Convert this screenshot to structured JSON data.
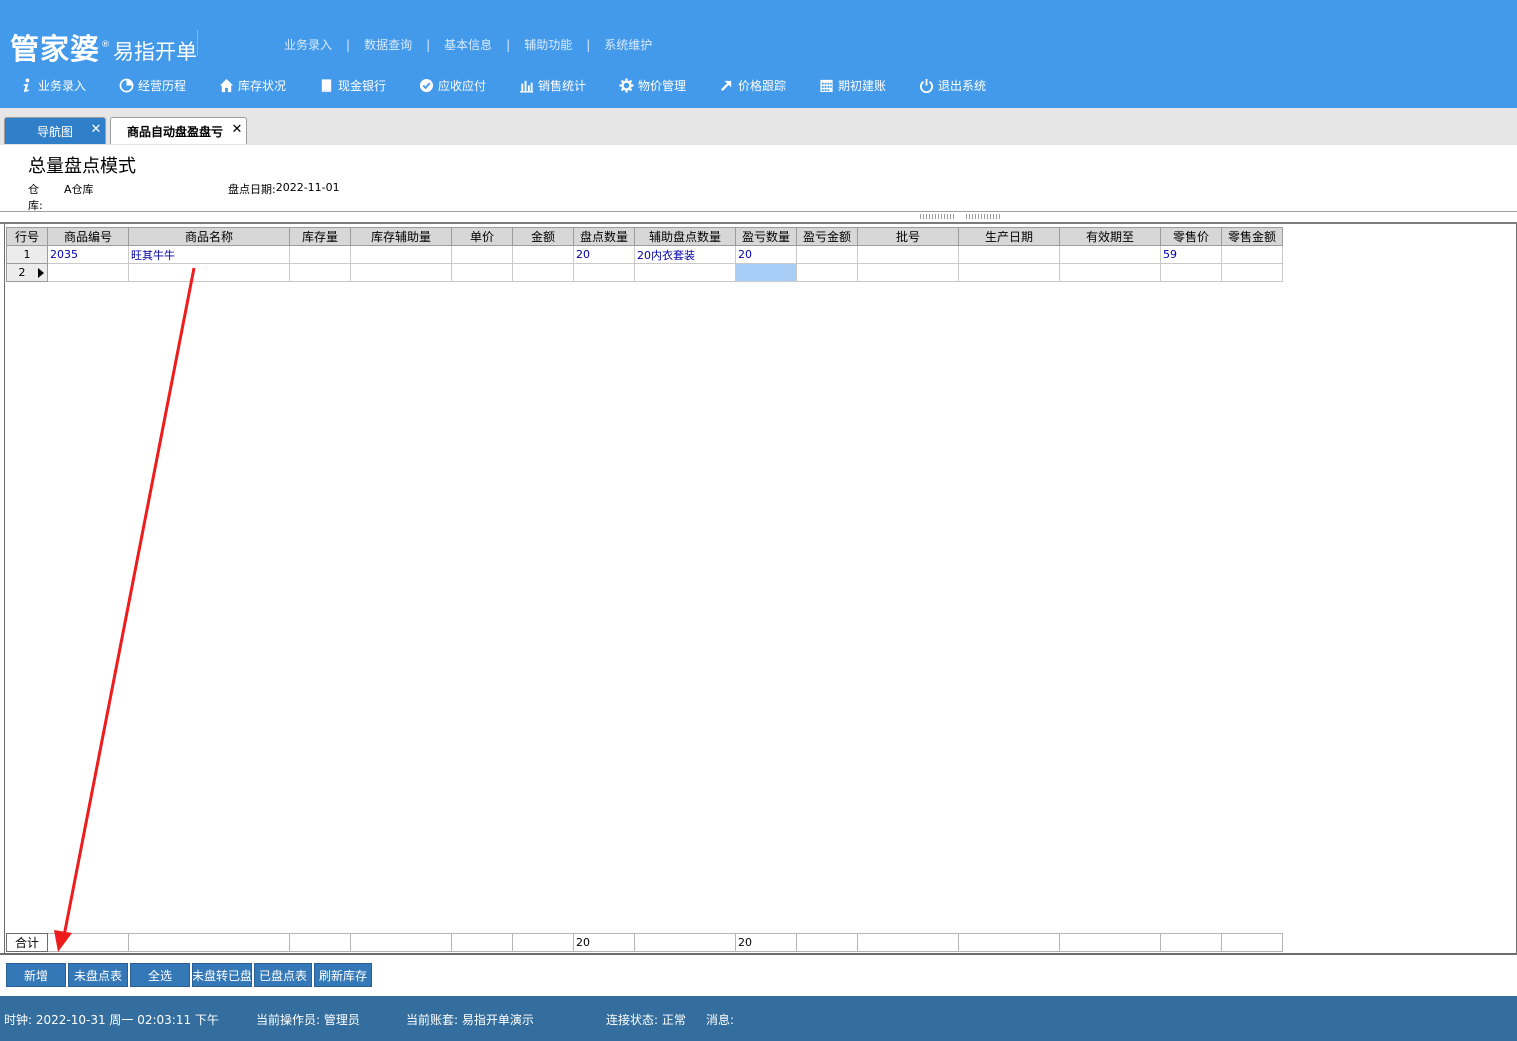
{
  "header": {
    "brand": "管家婆",
    "registered_mark": "®",
    "product": "易指开单",
    "topnav": [
      "业务录入",
      "数据查询",
      "基本信息",
      "辅助功能",
      "系统维护"
    ],
    "topnav_separator": "|"
  },
  "toolbar": {
    "items": [
      {
        "label": "业务录入",
        "icon": "info-icon"
      },
      {
        "label": "经营历程",
        "icon": "pie-chart-icon"
      },
      {
        "label": "库存状况",
        "icon": "home-icon"
      },
      {
        "label": "现金银行",
        "icon": "book-icon"
      },
      {
        "label": "应收应付",
        "icon": "check-circle-icon"
      },
      {
        "label": "销售统计",
        "icon": "bar-chart-icon"
      },
      {
        "label": "物价管理",
        "icon": "gear-icon"
      },
      {
        "label": "价格跟踪",
        "icon": "arrow-up-right-icon"
      },
      {
        "label": "期初建账",
        "icon": "calendar-icon"
      },
      {
        "label": "退出系统",
        "icon": "power-icon"
      }
    ]
  },
  "tabs": [
    {
      "label": "导航图",
      "close": "✕",
      "active": false
    },
    {
      "label": "商品自动盘盈盘亏",
      "close": "✕",
      "active": true
    }
  ],
  "page": {
    "title": "总量盘点模式",
    "warehouse_label": "仓　　库:",
    "warehouse_value": "A仓库",
    "date_label": "盘点日期:",
    "date_value": "2022-11-01"
  },
  "grid": {
    "columns": [
      "行号",
      "商品编号",
      "商品名称",
      "库存量",
      "库存辅助量",
      "单价",
      "金额",
      "盘点数量",
      "辅助盘点数量",
      "盈亏数量",
      "盈亏金额",
      "批号",
      "生产日期",
      "有效期至",
      "零售价",
      "零售金额"
    ],
    "rows": [
      [
        "1",
        "2035",
        "旺其牛牛",
        "",
        "",
        "",
        "",
        "20",
        "20内衣套装",
        "20",
        "",
        "",
        "",
        "",
        "59",
        ""
      ],
      [
        "2",
        "",
        "",
        "",
        "",
        "",
        "",
        "",
        "",
        "",
        "",
        "",
        "",
        "",
        "",
        ""
      ]
    ],
    "totals_label": "合计",
    "totals": [
      "",
      "",
      "",
      "",
      "",
      "",
      "20",
      "",
      "20",
      "",
      "",
      "",
      "",
      "",
      ""
    ]
  },
  "actions": [
    "新增",
    "未盘点表",
    "全选",
    "未盘转已盘",
    "已盘点表",
    "刷新库存"
  ],
  "status": {
    "clock": "时钟: 2022-10-31 周一 02:03:11 下午",
    "operator": "当前操作员: 管理员",
    "account": "当前账套: 易指开单演示",
    "connection": "连接状态: 正常",
    "message": "消息:"
  },
  "colors": {
    "header_bg": "#4399ea",
    "tab_active_bg": "#ffffff",
    "tab_nav_bg": "#2f7fc9",
    "button_bg": "#3478b8",
    "status_bg": "#336e9e",
    "annotation_arrow": "#ee1c1c"
  }
}
